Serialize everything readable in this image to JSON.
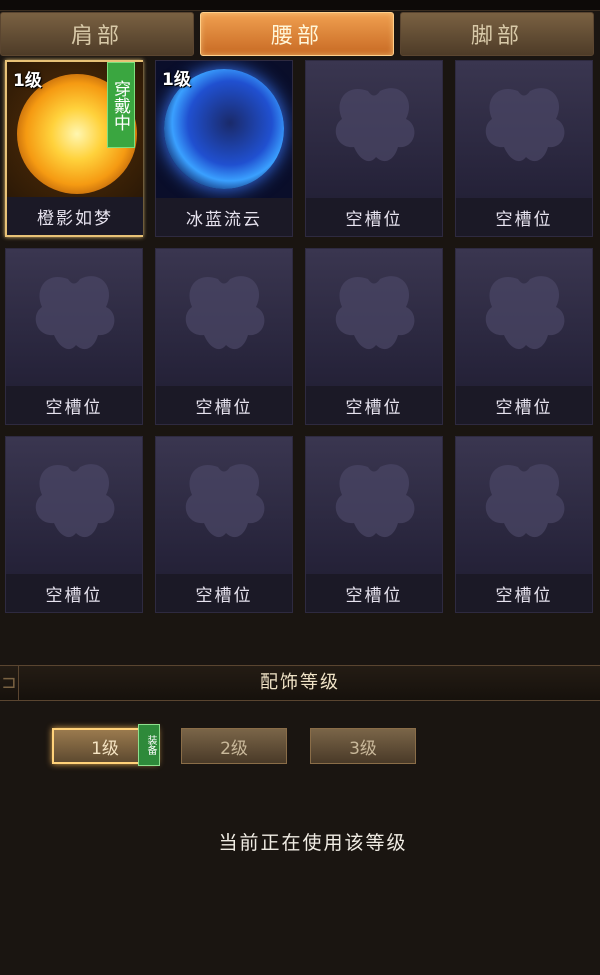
{
  "tabs": [
    {
      "label": "肩部"
    },
    {
      "label": "腰部"
    },
    {
      "label": "脚部"
    }
  ],
  "slots": [
    {
      "level": "1级",
      "name": "橙影如梦",
      "badge": "穿戴中"
    },
    {
      "level": "1级",
      "name": "冰蓝流云"
    },
    {
      "name": "空槽位"
    },
    {
      "name": "空槽位"
    },
    {
      "name": "空槽位"
    },
    {
      "name": "空槽位"
    },
    {
      "name": "空槽位"
    },
    {
      "name": "空槽位"
    },
    {
      "name": "空槽位"
    },
    {
      "name": "空槽位"
    },
    {
      "name": "空槽位"
    },
    {
      "name": "空槽位"
    }
  ],
  "section": {
    "title": "配饰等级"
  },
  "levels": [
    {
      "label": "1级",
      "badge": "装备"
    },
    {
      "label": "2级"
    },
    {
      "label": "3级"
    }
  ],
  "status_text": "当前正在使用该等级",
  "colors": {
    "active_tab": "#e0843a",
    "selected_border": "#e8c277",
    "wear_badge": "#3aa640"
  }
}
